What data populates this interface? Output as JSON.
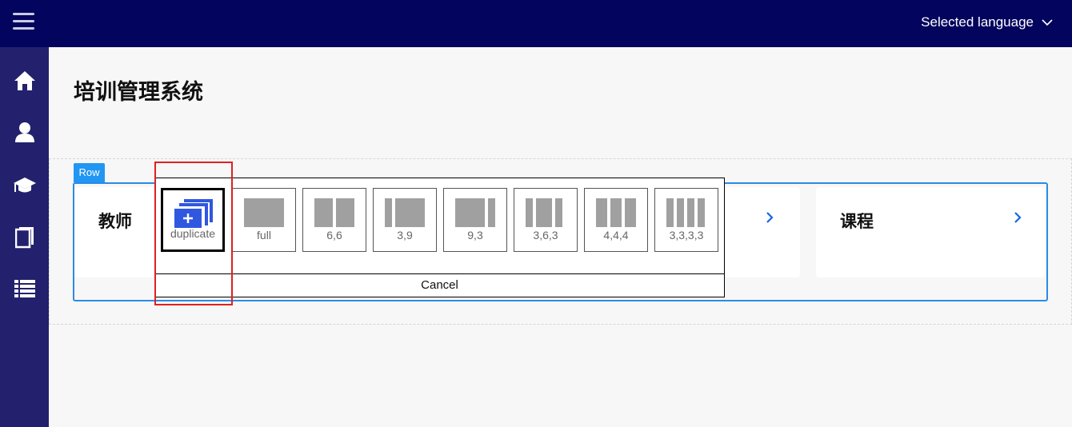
{
  "header": {
    "language_label": "Selected language"
  },
  "sidebar": {
    "items": [
      "home-icon",
      "user-icon",
      "graduation-cap-icon",
      "book-icon",
      "list-icon"
    ]
  },
  "page": {
    "title": "培训管理系统"
  },
  "row": {
    "tag": "Row"
  },
  "cards": [
    {
      "title": "教师"
    },
    {
      "title": "课程"
    }
  ],
  "layout_picker": {
    "options": [
      "duplicate",
      "full",
      "6,6",
      "3,9",
      "9,3",
      "3,6,3",
      "4,4,4",
      "3,3,3,3"
    ],
    "cancel_label": "Cancel"
  },
  "colors": {
    "topbar": "#03045e",
    "sidebar": "#23216d",
    "accent": "#2b8ae6",
    "highlight": "#e02020"
  }
}
